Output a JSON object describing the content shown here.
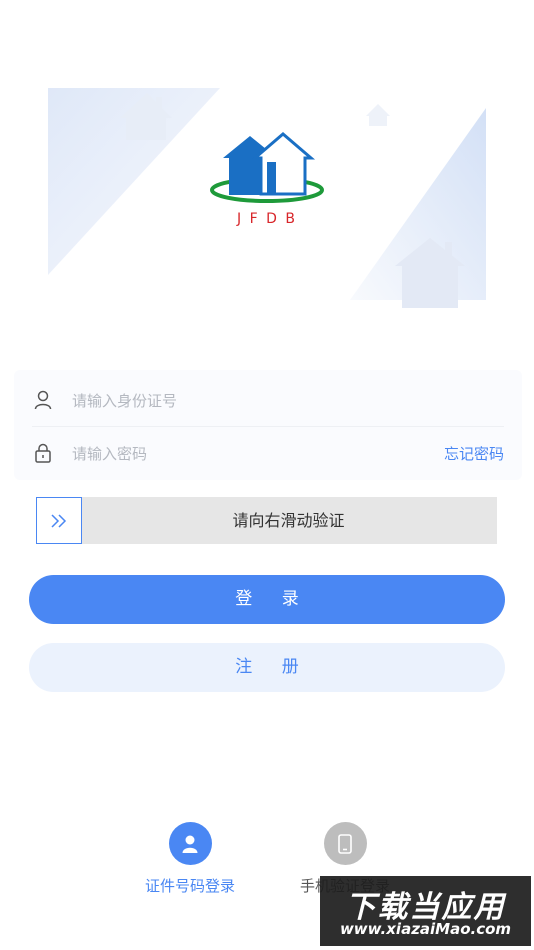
{
  "logo": {
    "letters": "J F D B"
  },
  "form": {
    "id_placeholder": "请输入身份证号",
    "password_placeholder": "请输入密码",
    "forgot_password": "忘记密码"
  },
  "slider": {
    "label": "请向右滑动验证",
    "progress": 0
  },
  "buttons": {
    "login": "登 录",
    "register": "注 册"
  },
  "login_options": [
    {
      "label": "证件号码登录",
      "icon": "person-icon",
      "active": true
    },
    {
      "label": "手机验证登录",
      "icon": "phone-icon",
      "active": false
    }
  ],
  "watermark": {
    "line1": "下载当应用",
    "line2": "www.xiazaiMao.com"
  },
  "colors": {
    "accent": "#4a87f3",
    "accent_light": "#ebf2fd",
    "logo_blue": "#1a6fc4",
    "logo_green": "#1e9a3a",
    "logo_red": "#d8262a"
  }
}
